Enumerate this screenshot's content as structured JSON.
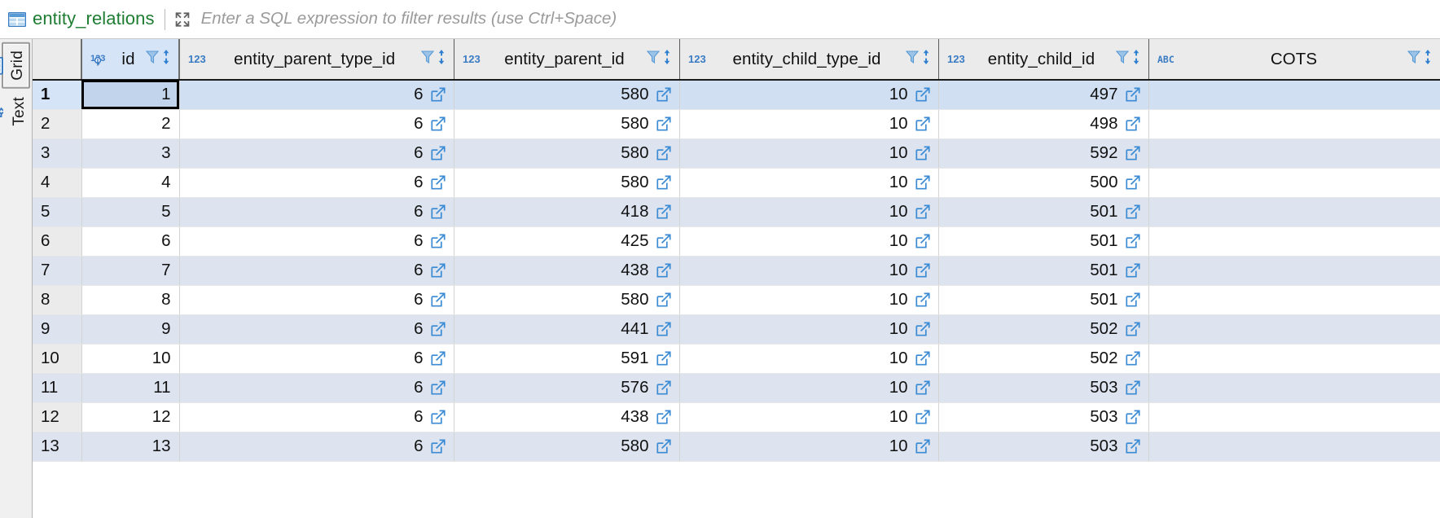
{
  "toolbar": {
    "table_icon": "table-icon",
    "table_name": "entity_relations",
    "expand_icon": "expand-maximize-icon",
    "sql_filter_placeholder": "Enter a SQL expression to filter results (use Ctrl+Space)",
    "sql_filter_value": ""
  },
  "sidebar": {
    "tabs": [
      {
        "label": "Grid",
        "icon": "grid-icon",
        "active": true
      },
      {
        "label": "Text",
        "icon": "text-cursor-icon",
        "active": false
      }
    ]
  },
  "colors": {
    "table_name": "#1e7d32",
    "type_badge": "#3a7cc4",
    "fk_link": "#3a8ad4",
    "header_bg": "#ebebeb",
    "selected_row": "#d0dff2",
    "alt_row": "#dde4f0",
    "filter_icon": "#9cc3e8",
    "sort_arrow": "#2f7fd0"
  },
  "grid": {
    "rownum_header": "",
    "columns": [
      {
        "name": "id",
        "type_badge": "123",
        "pk": true,
        "filter_icon": "filter-icon",
        "sort_icon": "sort-updown-icon",
        "selected": true
      },
      {
        "name": "entity_parent_type_id",
        "type_badge": "123",
        "pk": false,
        "filter_icon": "filter-icon",
        "sort_icon": "sort-updown-icon",
        "selected": false
      },
      {
        "name": "entity_parent_id",
        "type_badge": "123",
        "pk": false,
        "filter_icon": "filter-icon",
        "sort_icon": "sort-updown-icon",
        "selected": false
      },
      {
        "name": "entity_child_type_id",
        "type_badge": "123",
        "pk": false,
        "filter_icon": "filter-icon",
        "sort_icon": "sort-updown-icon",
        "selected": false
      },
      {
        "name": "entity_child_id",
        "type_badge": "123",
        "pk": false,
        "filter_icon": "filter-icon",
        "sort_icon": "sort-updown-icon",
        "selected": false
      },
      {
        "name": "COTS",
        "type_badge": "ABC",
        "pk": false,
        "filter_icon": "filter-icon",
        "sort_icon": "sort-updown-icon",
        "selected": false
      }
    ],
    "rows": [
      {
        "rownum": "1",
        "id": "1",
        "entity_parent_type_id": "6",
        "entity_parent_id": "580",
        "entity_child_type_id": "10",
        "entity_child_id": "497",
        "COTS": "",
        "selected": true
      },
      {
        "rownum": "2",
        "id": "2",
        "entity_parent_type_id": "6",
        "entity_parent_id": "580",
        "entity_child_type_id": "10",
        "entity_child_id": "498",
        "COTS": "",
        "selected": false
      },
      {
        "rownum": "3",
        "id": "3",
        "entity_parent_type_id": "6",
        "entity_parent_id": "580",
        "entity_child_type_id": "10",
        "entity_child_id": "592",
        "COTS": "",
        "selected": false
      },
      {
        "rownum": "4",
        "id": "4",
        "entity_parent_type_id": "6",
        "entity_parent_id": "580",
        "entity_child_type_id": "10",
        "entity_child_id": "500",
        "COTS": "",
        "selected": false
      },
      {
        "rownum": "5",
        "id": "5",
        "entity_parent_type_id": "6",
        "entity_parent_id": "418",
        "entity_child_type_id": "10",
        "entity_child_id": "501",
        "COTS": "",
        "selected": false
      },
      {
        "rownum": "6",
        "id": "6",
        "entity_parent_type_id": "6",
        "entity_parent_id": "425",
        "entity_child_type_id": "10",
        "entity_child_id": "501",
        "COTS": "",
        "selected": false
      },
      {
        "rownum": "7",
        "id": "7",
        "entity_parent_type_id": "6",
        "entity_parent_id": "438",
        "entity_child_type_id": "10",
        "entity_child_id": "501",
        "COTS": "",
        "selected": false
      },
      {
        "rownum": "8",
        "id": "8",
        "entity_parent_type_id": "6",
        "entity_parent_id": "580",
        "entity_child_type_id": "10",
        "entity_child_id": "501",
        "COTS": "",
        "selected": false
      },
      {
        "rownum": "9",
        "id": "9",
        "entity_parent_type_id": "6",
        "entity_parent_id": "441",
        "entity_child_type_id": "10",
        "entity_child_id": "502",
        "COTS": "",
        "selected": false
      },
      {
        "rownum": "10",
        "id": "10",
        "entity_parent_type_id": "6",
        "entity_parent_id": "591",
        "entity_child_type_id": "10",
        "entity_child_id": "502",
        "COTS": "",
        "selected": false
      },
      {
        "rownum": "11",
        "id": "11",
        "entity_parent_type_id": "6",
        "entity_parent_id": "576",
        "entity_child_type_id": "10",
        "entity_child_id": "503",
        "COTS": "",
        "selected": false
      },
      {
        "rownum": "12",
        "id": "12",
        "entity_parent_type_id": "6",
        "entity_parent_id": "438",
        "entity_child_type_id": "10",
        "entity_child_id": "503",
        "COTS": "",
        "selected": false
      },
      {
        "rownum": "13",
        "id": "13",
        "entity_parent_type_id": "6",
        "entity_parent_id": "580",
        "entity_child_type_id": "10",
        "entity_child_id": "503",
        "COTS": "",
        "selected": false
      }
    ]
  }
}
